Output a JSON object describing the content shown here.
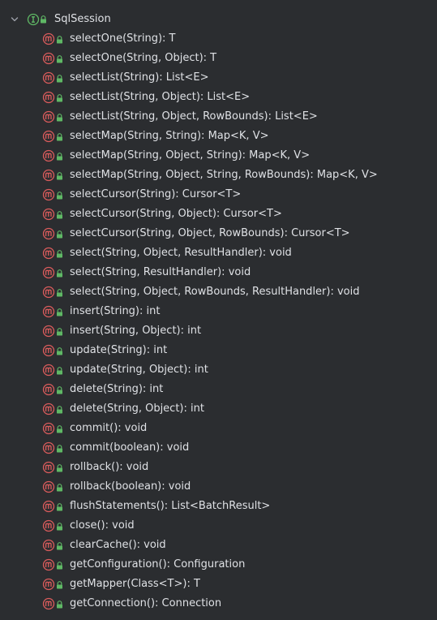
{
  "tree": {
    "root": {
      "label": "SqlSession",
      "icon": "interface-icon",
      "expanded": true
    },
    "methods": [
      "selectOne(String): T",
      "selectOne(String, Object): T",
      "selectList(String): List<E>",
      "selectList(String, Object): List<E>",
      "selectList(String, Object, RowBounds): List<E>",
      "selectMap(String, String): Map<K, V>",
      "selectMap(String, Object, String): Map<K, V>",
      "selectMap(String, Object, String, RowBounds): Map<K, V>",
      "selectCursor(String): Cursor<T>",
      "selectCursor(String, Object): Cursor<T>",
      "selectCursor(String, Object, RowBounds): Cursor<T>",
      "select(String, Object, ResultHandler): void",
      "select(String, ResultHandler): void",
      "select(String, Object, RowBounds, ResultHandler): void",
      "insert(String): int",
      "insert(String, Object): int",
      "update(String): int",
      "update(String, Object): int",
      "delete(String): int",
      "delete(String, Object): int",
      "commit(): void",
      "commit(boolean): void",
      "rollback(): void",
      "rollback(boolean): void",
      "flushStatements(): List<BatchResult>",
      "close(): void",
      "clearCache(): void",
      "getConfiguration(): Configuration",
      "getMapper(Class<T>): T",
      "getConnection(): Connection"
    ]
  },
  "colors": {
    "background": "#2b2d30",
    "text": "#dfe1e5",
    "method_icon": "#db5c5c",
    "interface_icon": "#5fb865",
    "lock_icon": "#5fb865",
    "chevron": "#9da0a8"
  }
}
